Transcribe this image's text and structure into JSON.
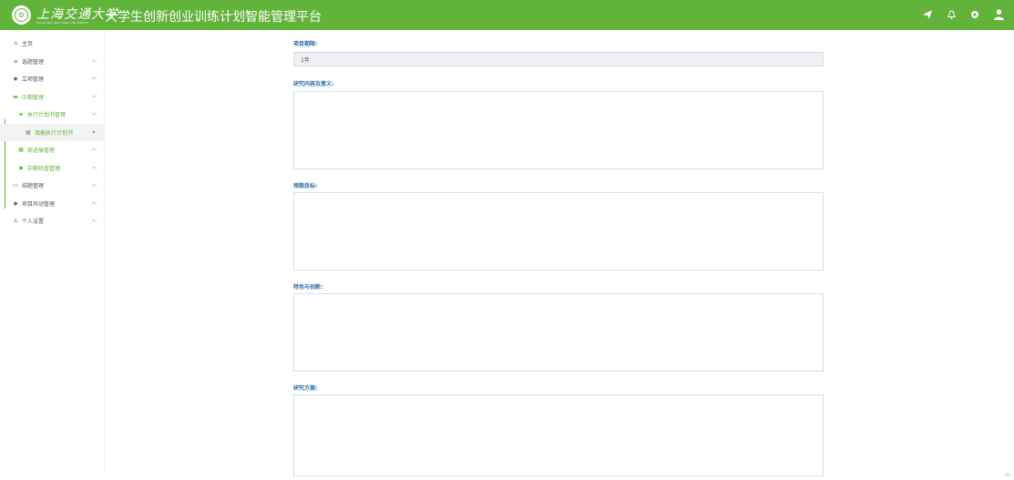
{
  "header": {
    "logo_text": "上海交通大学",
    "logo_subtext": "SHANGHAI JIAO TONG UNIVERSITY",
    "app_title": "大学生创新创业训练计划智能管理平台",
    "brand_color": "#61b33a",
    "icons": [
      "send-icon",
      "bell-icon",
      "settings-icon",
      "user-icon"
    ]
  },
  "sidebar": {
    "items": [
      {
        "label": "主页",
        "icon": "home-icon"
      },
      {
        "label": "选题管理",
        "icon": "list-icon"
      },
      {
        "label": "立项管理",
        "icon": "shield-icon"
      },
      {
        "label": "中期管理",
        "icon": "screen-icon"
      },
      {
        "label": "执行计划书管理",
        "icon": "book-icon"
      },
      {
        "label": "填报执行计划书",
        "icon": "doc-icon"
      },
      {
        "label": "周进展管理",
        "icon": "calendar-icon"
      },
      {
        "label": "中期检查管理",
        "icon": "check-icon"
      },
      {
        "label": "结题管理",
        "icon": "monitor-icon"
      },
      {
        "label": "项目异动管理",
        "icon": "shield-icon"
      },
      {
        "label": "个人设置",
        "icon": "person-icon"
      }
    ]
  },
  "form": {
    "duration": {
      "label": "项目期限:",
      "value": "1年"
    },
    "content": {
      "label": "研究内容及意义:"
    },
    "goals": {
      "label": "预期目标:"
    },
    "features": {
      "label": "特色与创新:"
    },
    "plan": {
      "label": "研究方案:"
    }
  }
}
